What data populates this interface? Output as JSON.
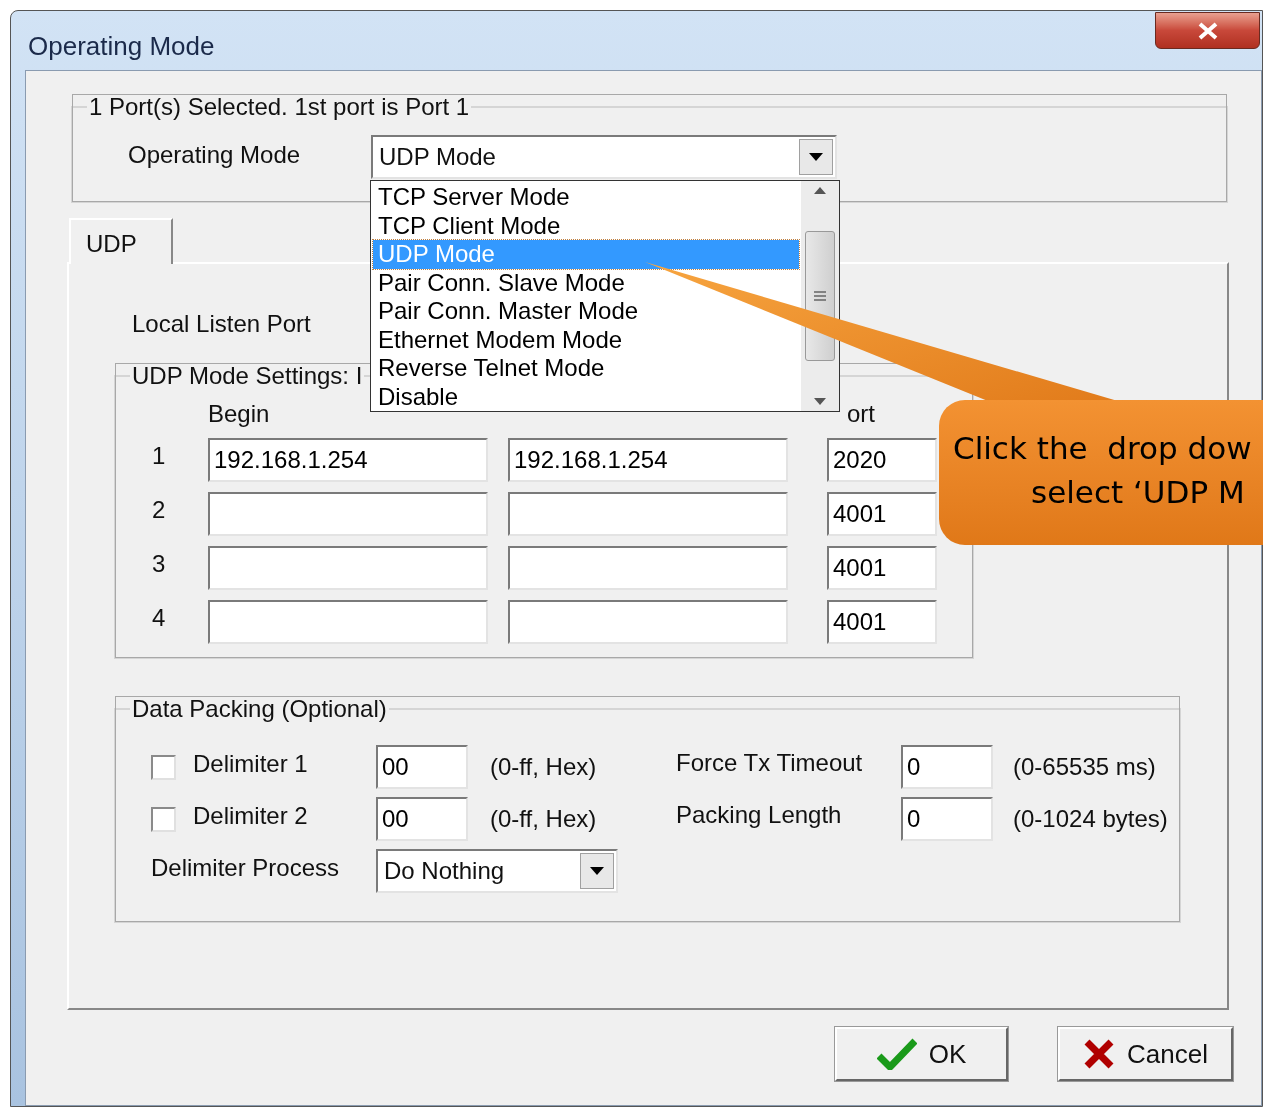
{
  "window": {
    "title": "Operating Mode"
  },
  "port_group": {
    "legend": "1 Port(s) Selected. 1st port is Port 1",
    "operating_mode": {
      "label": "Operating Mode",
      "value": "UDP Mode"
    }
  },
  "mode_list": {
    "items": [
      {
        "label": "TCP Server Mode",
        "selected": false
      },
      {
        "label": "TCP Client Mode",
        "selected": false
      },
      {
        "label": "UDP Mode",
        "selected": true
      },
      {
        "label": "Pair Conn. Slave Mode",
        "selected": false
      },
      {
        "label": "Pair Conn. Master Mode",
        "selected": false
      },
      {
        "label": "Ethernet Modem Mode",
        "selected": false
      },
      {
        "label": "Reverse Telnet Mode",
        "selected": false
      },
      {
        "label": "Disable",
        "selected": false
      }
    ]
  },
  "tabs": [
    {
      "label": "UDP",
      "selected": true
    }
  ],
  "local_listen_port": {
    "label": "Local Listen Port"
  },
  "udp_settings": {
    "legend": "UDP Mode Settings: I",
    "columns": [
      "Begin",
      "ort"
    ],
    "rows": [
      {
        "index": "1",
        "begin": "192.168.1.254",
        "end": "192.168.1.254",
        "port": "2020"
      },
      {
        "index": "2",
        "port": "4001"
      },
      {
        "index": "3",
        "port": "4001"
      },
      {
        "index": "4",
        "port": "4001"
      }
    ]
  },
  "data_packing": {
    "legend": "Data Packing (Optional)",
    "delimiters": [
      {
        "label": "Delimiter 1",
        "checked": false,
        "value": "00",
        "hint": "(0-ff, Hex)"
      },
      {
        "label": "Delimiter 2",
        "checked": false,
        "value": "00",
        "hint": "(0-ff, Hex)"
      }
    ],
    "settings": [
      {
        "label": "Force Tx Timeout",
        "value": "0",
        "hint": "(0-65535 ms)"
      },
      {
        "label": "Packing Length",
        "value": "0",
        "hint": "(0-1024 bytes)"
      }
    ],
    "process": {
      "label": "Delimiter Process",
      "value": "Do Nothing"
    }
  },
  "buttons": [
    {
      "kind": "ok",
      "label": "OK"
    },
    {
      "kind": "cancel",
      "label": "Cancel"
    }
  ],
  "callout": {
    "lines": [
      "Click the  drop dow",
      "select ‘UDP M"
    ]
  }
}
